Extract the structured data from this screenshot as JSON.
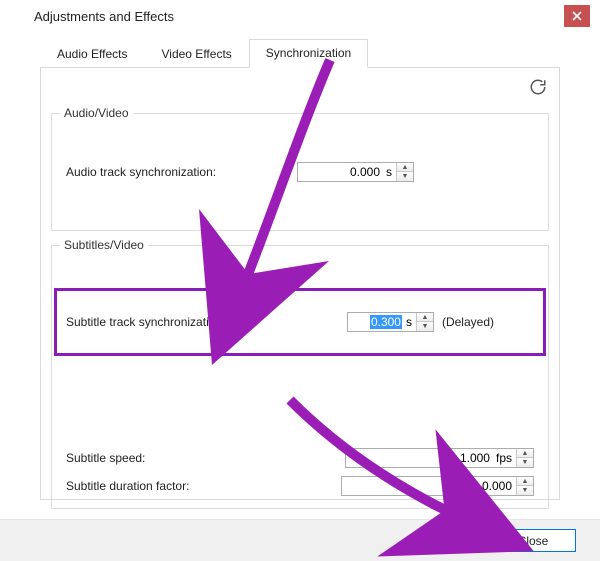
{
  "window": {
    "title": "Adjustments and Effects"
  },
  "tabs": {
    "audio": "Audio Effects",
    "video": "Video Effects",
    "sync": "Synchronization"
  },
  "audio_video": {
    "legend": "Audio/Video",
    "audio_sync_label": "Audio track synchronization:",
    "audio_sync_value": "0.000",
    "audio_sync_suffix": "s"
  },
  "subtitles_video": {
    "legend": "Subtitles/Video",
    "sub_sync_label": "Subtitle track synchronization:",
    "sub_sync_value": "0.300",
    "sub_sync_suffix": "s",
    "sub_sync_status": "(Delayed)",
    "sub_speed_label": "Subtitle speed:",
    "sub_speed_value": "1.000",
    "sub_speed_suffix": "fps",
    "sub_dur_label": "Subtitle duration factor:",
    "sub_dur_value": "0.000"
  },
  "buttons": {
    "close": "Close"
  },
  "colors": {
    "annotation": "#9a1db6",
    "close_btn": "#c75050"
  }
}
